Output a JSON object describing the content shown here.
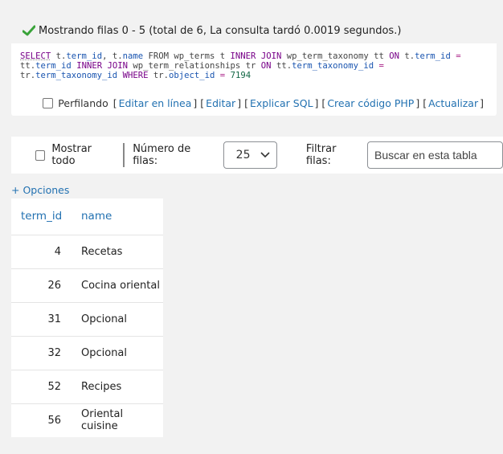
{
  "result": {
    "message": "Mostrando filas 0 - 5 (total de 6, La consulta tardó 0.0019 segundos.)",
    "icon": "check-icon"
  },
  "sql": {
    "line1": [
      "SELECT",
      " t.",
      "term_id",
      ", t.",
      "name",
      " FROM wp_terms t ",
      "INNER JOIN",
      " wp_term_taxonomy tt ",
      "ON",
      " t.",
      "term_id",
      " ",
      "="
    ],
    "line2": [
      "tt.",
      "term_id",
      " ",
      "INNER JOIN",
      " wp_term_relationships tr ",
      "ON",
      " tt.",
      "term_taxonomy_id",
      " ",
      "="
    ],
    "line3": [
      "tr.",
      "term_taxonomy_id",
      " ",
      "WHERE",
      " tr.",
      "object_id",
      " ",
      "=",
      " ",
      "7194"
    ]
  },
  "profiling": {
    "label": "Perfilando",
    "links": [
      "Editar en línea",
      "Editar",
      "Explicar SQL",
      "Crear código PHP",
      "Actualizar"
    ]
  },
  "nav": {
    "show_all_label": "Mostrar todo",
    "rows_label": "Número de filas:",
    "rows_value": "25",
    "filter_label": "Filtrar filas:",
    "search_placeholder": "Buscar en esta tabla"
  },
  "options_link": "+ Opciones",
  "table": {
    "headers": [
      "term_id",
      "name"
    ],
    "rows": [
      [
        "4",
        "Recetas"
      ],
      [
        "26",
        "Cocina oriental"
      ],
      [
        "31",
        "Opcional"
      ],
      [
        "32",
        "Opcional"
      ],
      [
        "52",
        "Recipes"
      ],
      [
        "56",
        "Oriental cuisine"
      ]
    ]
  },
  "colors": {
    "link": "#2271b1",
    "success_check": "#3aa33a",
    "sql_keyword": "#770088",
    "sql_column": "#1a55b0"
  }
}
